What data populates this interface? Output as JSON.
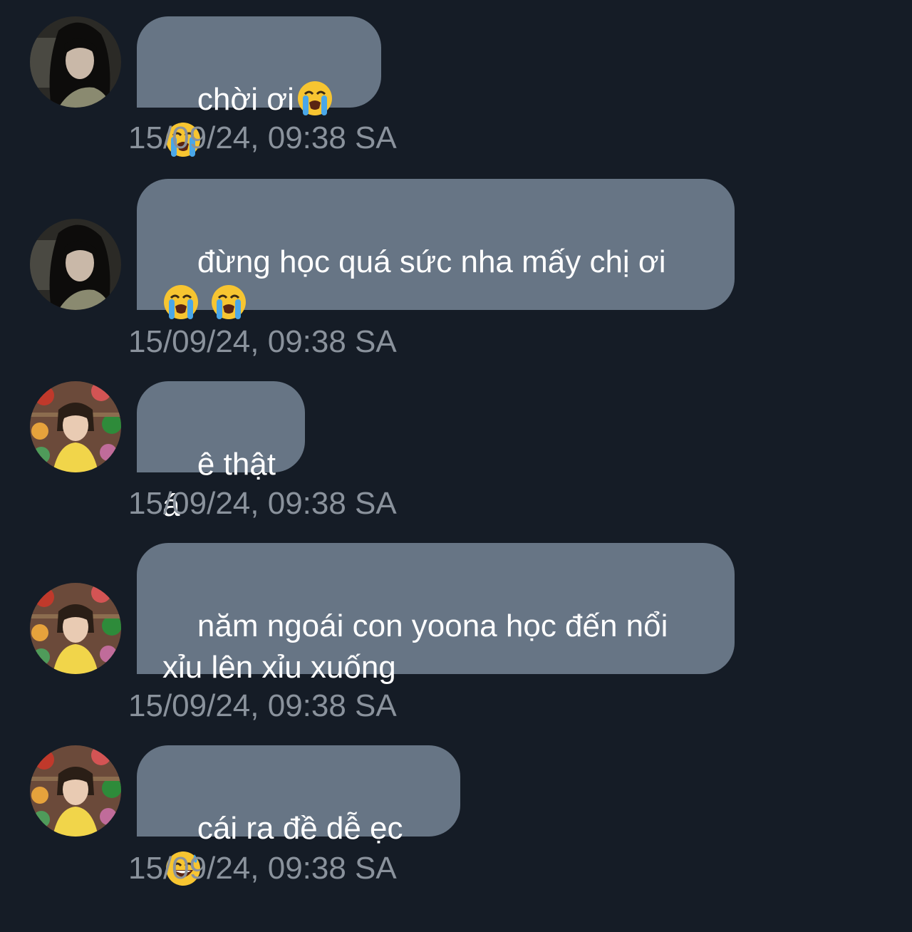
{
  "messages": [
    {
      "sender_avatar": "avatar-dark-hair-girl",
      "text": "chời ơi",
      "emoji": [
        "loudly-crying-face-icon",
        "loudly-crying-face-icon"
      ],
      "timestamp": "15/09/24, 09:38 SA"
    },
    {
      "sender_avatar": "avatar-dark-hair-girl",
      "text": "đừng học quá sức nha mấy chị ơi",
      "emoji": [
        "loudly-crying-face-icon",
        "loudly-crying-face-icon"
      ],
      "timestamp": "15/09/24, 09:38 SA"
    },
    {
      "sender_avatar": "avatar-girl-yellow-top",
      "text": "ê thật á",
      "emoji": [],
      "timestamp": "15/09/24, 09:38 SA"
    },
    {
      "sender_avatar": "avatar-girl-yellow-top",
      "text": "năm ngoái con yoona học đến nổi xỉu lên xỉu xuống",
      "emoji": [],
      "timestamp": "15/09/24, 09:38 SA"
    },
    {
      "sender_avatar": "avatar-girl-yellow-top",
      "text": "cái ra đề dễ ẹc",
      "emoji": [
        "grinning-face-with-sweat-icon"
      ],
      "timestamp": "15/09/24, 09:38 SA"
    }
  ],
  "colors": {
    "background": "#151c26",
    "bubble": "#677585",
    "timestamp": "#8a929c",
    "text": "#ffffff"
  }
}
